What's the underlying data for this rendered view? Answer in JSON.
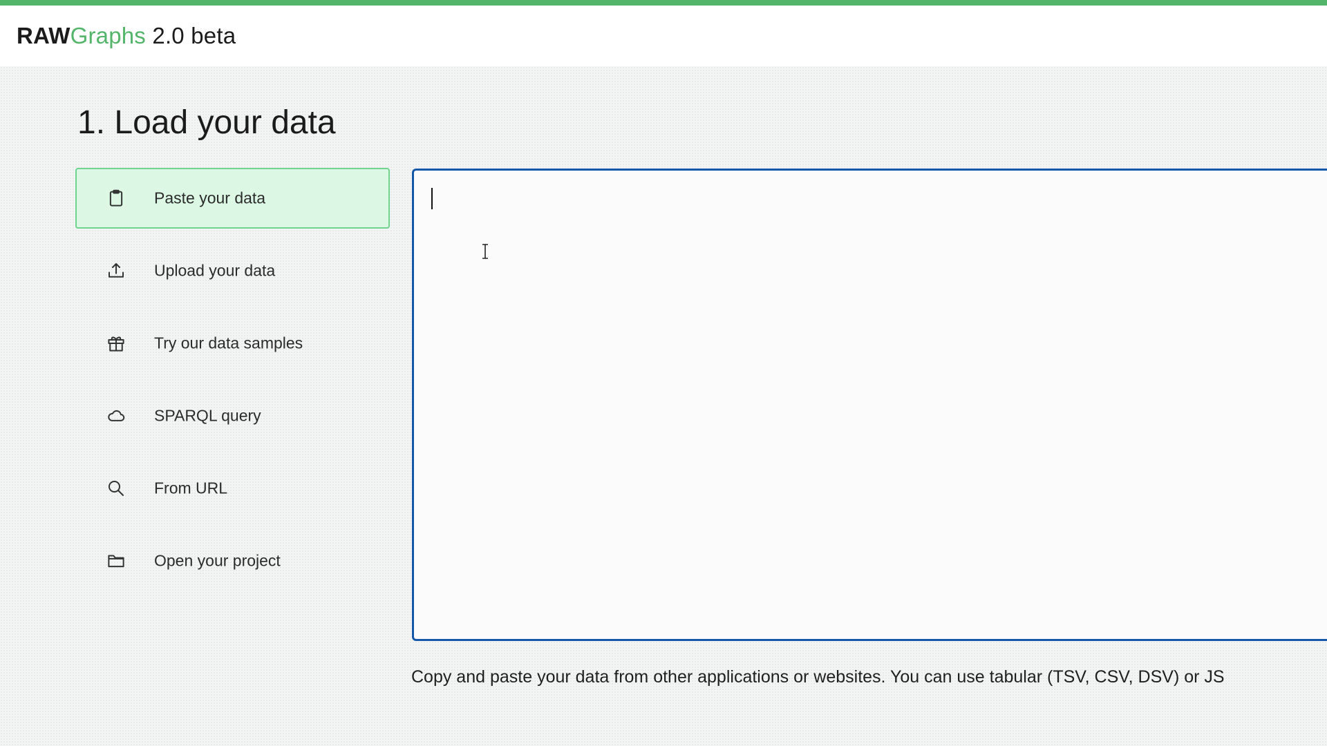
{
  "header": {
    "brand_raw": "RAW",
    "brand_graphs": "Graphs",
    "version": "2.0 beta"
  },
  "page": {
    "title": "1. Load your data"
  },
  "sources": [
    {
      "label": "Paste your data",
      "icon": "clipboard-icon",
      "active": true
    },
    {
      "label": "Upload your data",
      "icon": "upload-icon",
      "active": false
    },
    {
      "label": "Try our data samples",
      "icon": "gift-icon",
      "active": false
    },
    {
      "label": "SPARQL query",
      "icon": "cloud-icon",
      "active": false
    },
    {
      "label": "From URL",
      "icon": "search-icon",
      "active": false
    },
    {
      "label": "Open your project",
      "icon": "folder-icon",
      "active": false
    }
  ],
  "paste": {
    "value": "",
    "help": "Copy and paste your data from other applications or websites. You can use tabular (TSV, CSV, DSV) or JS"
  },
  "colors": {
    "accent_green": "#53b56a",
    "active_bg": "#dcf8e5",
    "active_border": "#6ed48d",
    "textarea_border": "#1456a9"
  }
}
